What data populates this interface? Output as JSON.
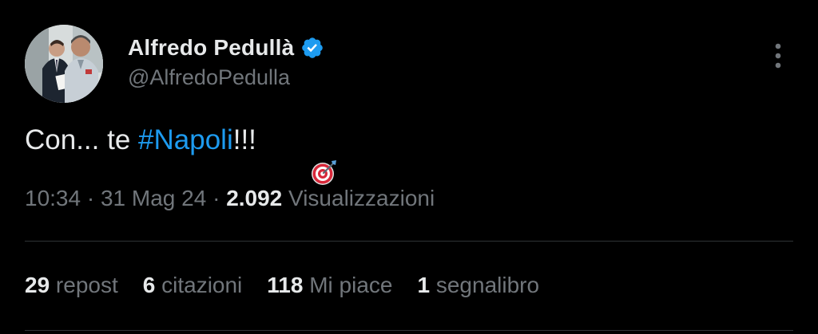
{
  "author": {
    "display_name": "Alfredo Pedullà",
    "handle": "@AlfredoPedulla",
    "verified": true
  },
  "tweet": {
    "text_before": "Con... te ",
    "hashtag": "#Napoli",
    "text_after": "!!!",
    "emoji_icon": "direct-hit-target-icon"
  },
  "meta": {
    "time": "10:34",
    "separator": " · ",
    "date": "31 Mag 24",
    "views_count": "2.092",
    "views_label": " Visualizzazioni"
  },
  "stats": [
    {
      "count": "29",
      "label": " repost"
    },
    {
      "count": "6",
      "label": " citazioni"
    },
    {
      "count": "118",
      "label": " Mi piace"
    },
    {
      "count": "1",
      "label": " segnalibro"
    }
  ],
  "colors": {
    "background": "#000000",
    "text_primary": "#e7e9ea",
    "text_secondary": "#71767b",
    "accent": "#1d9bf0",
    "divider": "#2f3336"
  }
}
